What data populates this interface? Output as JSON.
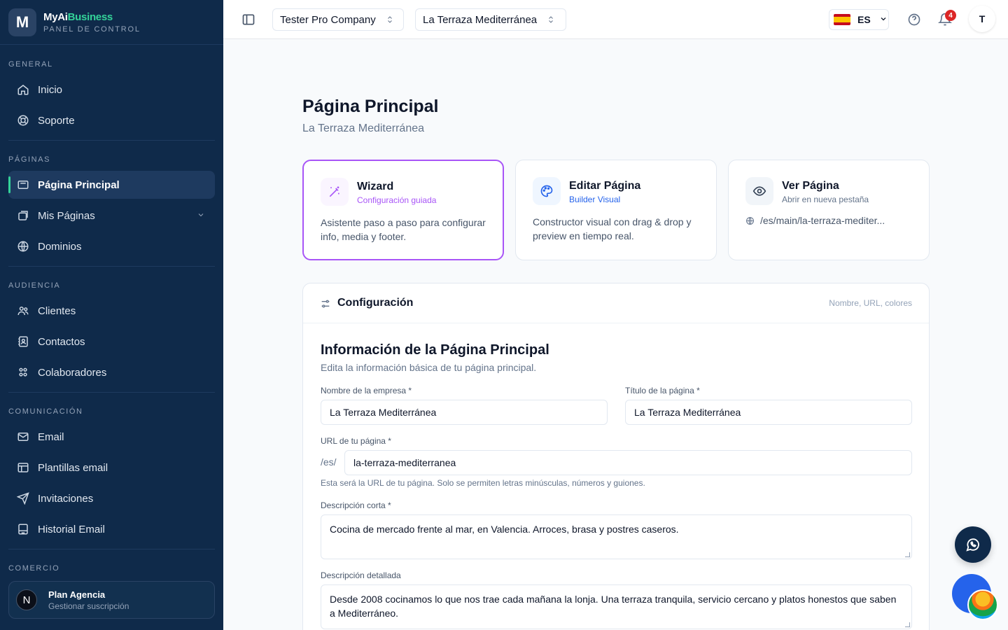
{
  "brand": {
    "name_main": "MyAi",
    "name_accent": "Business",
    "subtitle": "PANEL DE CONTROL",
    "logo_letter": "M"
  },
  "sidebar": {
    "sections": {
      "general": "GENERAL",
      "paginas": "PÁGINAS",
      "audiencia": "AUDIENCIA",
      "comunicacion": "COMUNICACIÓN",
      "comercio": "COMERCIO"
    },
    "items": {
      "inicio": "Inicio",
      "soporte": "Soporte",
      "pagina_principal": "Página Principal",
      "mis_paginas": "Mis Páginas",
      "dominios": "Dominios",
      "clientes": "Clientes",
      "contactos": "Contactos",
      "colaboradores": "Colaboradores",
      "email": "Email",
      "plantillas_email": "Plantillas email",
      "invitaciones": "Invitaciones",
      "historial_email": "Historial Email"
    },
    "plan": {
      "avatar_letter": "N",
      "title": "Plan Agencia",
      "subtitle": "Gestionar suscripción"
    }
  },
  "topbar": {
    "company_selector": "Tester Pro Company",
    "site_selector": "La Terraza Mediterránea",
    "language": "ES",
    "notifications_count": "4",
    "user_initial": "T"
  },
  "main": {
    "title": "Página Principal",
    "subtitle": "La Terraza Mediterránea",
    "cards": {
      "wizard": {
        "title": "Wizard",
        "subtitle": "Configuración guiada",
        "description": "Asistente paso a paso para configurar info, media y footer."
      },
      "editar": {
        "title": "Editar Página",
        "subtitle": "Builder Visual",
        "description": "Constructor visual con drag & drop y preview en tiempo real."
      },
      "ver": {
        "title": "Ver Página",
        "subtitle": "Abrir en nueva pestaña",
        "url": "/es/main/la-terraza-mediter..."
      }
    },
    "config": {
      "title": "Configuración",
      "hint": "Nombre, URL, colores",
      "section_title": "Información de la Página Principal",
      "section_subtitle": "Edita la información básica de tu página principal.",
      "fields": {
        "empresa_label": "Nombre de la empresa *",
        "empresa_value": "La Terraza Mediterránea",
        "titulo_label": "Título de la página *",
        "titulo_value": "La Terraza Mediterránea",
        "url_label": "URL de tu página *",
        "url_prefix": "/es/",
        "url_value": "la-terraza-mediterranea",
        "url_hint": "Esta será la URL de tu página. Solo se permiten letras minúsculas, números y guiones.",
        "corta_label": "Descripción corta *",
        "corta_value": "Cocina de mercado frente al mar, en Valencia. Arroces, brasa y postres caseros.",
        "detallada_label": "Descripción detallada",
        "detallada_value": "Desde 2008 cocinamos lo que nos trae cada mañana la lonja. Una terraza tranquila, servicio cercano y platos honestos que saben a Mediterráneo."
      }
    }
  },
  "colors": {
    "sidebar_bg": "#0f2a4a",
    "accent_green": "#34d399",
    "wizard_purple": "#a855f7",
    "builder_blue": "#2563eb"
  }
}
